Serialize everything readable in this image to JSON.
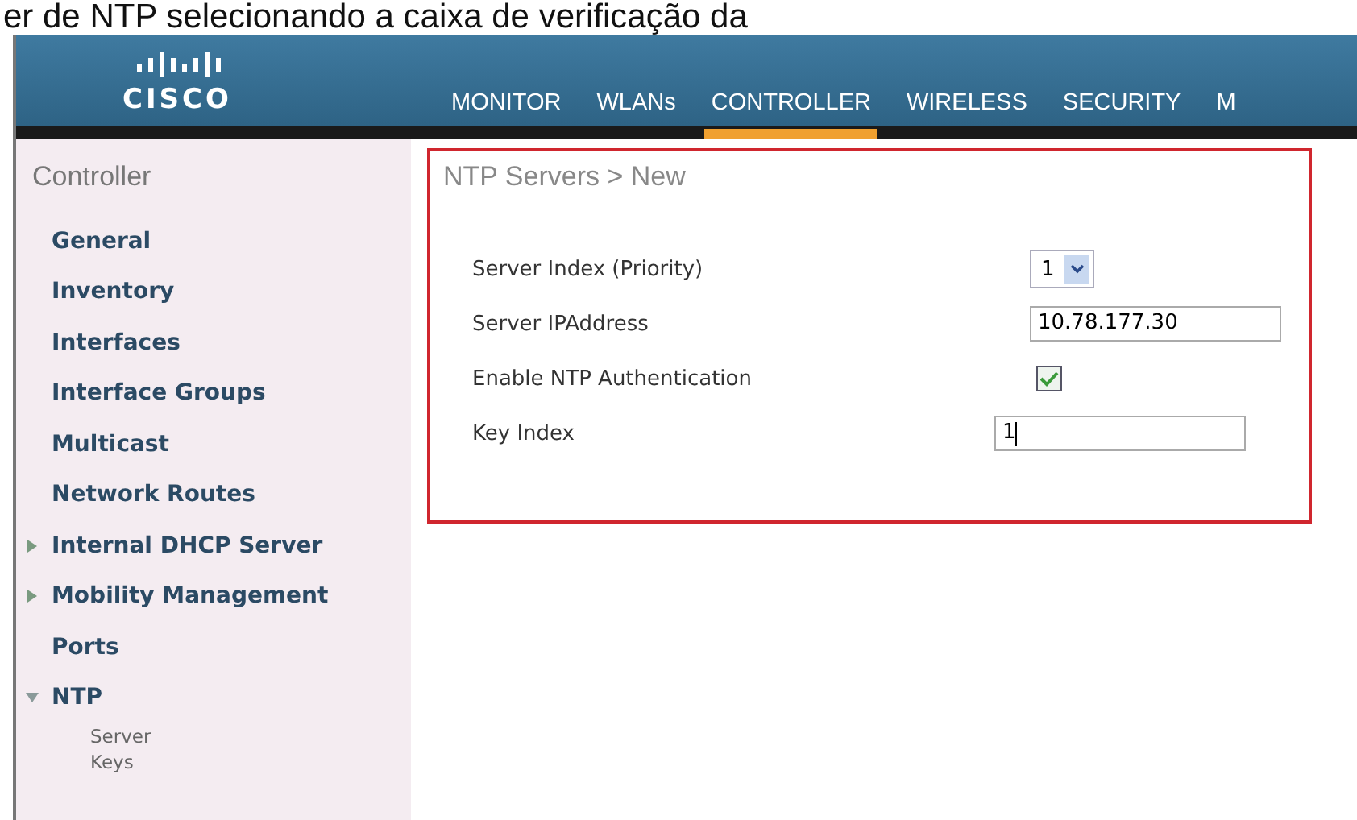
{
  "caption": "er de NTP selecionando a caixa de verificação da",
  "logo": {
    "text": "CISCO"
  },
  "nav": [
    {
      "label": "MONITOR",
      "selected": false
    },
    {
      "label": "WLANs",
      "selected": false
    },
    {
      "label": "CONTROLLER",
      "selected": true
    },
    {
      "label": "WIRELESS",
      "selected": false
    },
    {
      "label": "SECURITY",
      "selected": false
    },
    {
      "label": "M",
      "selected": false
    }
  ],
  "sidebar": {
    "title": "Controller",
    "items": [
      {
        "label": "General"
      },
      {
        "label": "Inventory"
      },
      {
        "label": "Interfaces"
      },
      {
        "label": "Interface Groups"
      },
      {
        "label": "Multicast"
      },
      {
        "label": "Network Routes"
      },
      {
        "label": "Internal DHCP Server",
        "expanded": false
      },
      {
        "label": "Mobility Management",
        "expanded": false
      },
      {
        "label": "Ports"
      },
      {
        "label": "NTP",
        "expanded": true,
        "children": [
          {
            "label": "Server"
          },
          {
            "label": "Keys"
          }
        ]
      }
    ]
  },
  "panel": {
    "title": "NTP Servers > New",
    "fields": [
      {
        "kind": "select",
        "label": "Server Index (Priority)",
        "value": "1"
      },
      {
        "kind": "text",
        "label": "Server IPAddress",
        "value": "10.78.177.30"
      },
      {
        "kind": "checkbox",
        "label": "Enable NTP Authentication",
        "checked": true
      },
      {
        "kind": "text",
        "label": "Key Index",
        "value": "1"
      }
    ]
  }
}
